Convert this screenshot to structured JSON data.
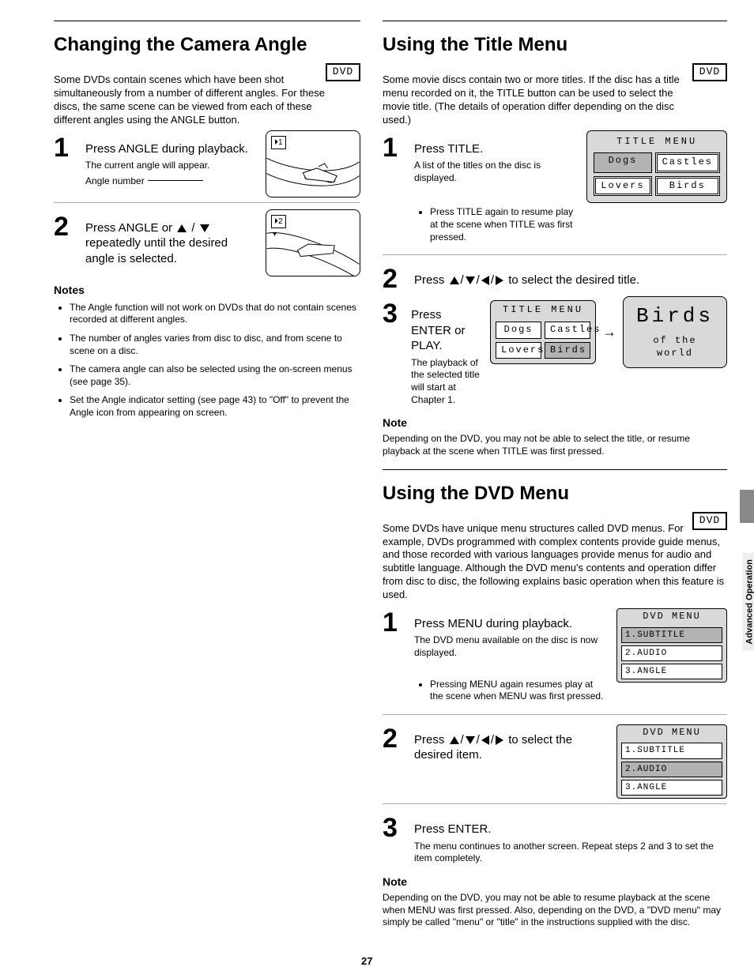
{
  "page_number": "27",
  "tab": "Advanced Operation",
  "left": {
    "title": "Changing the Camera Angle",
    "disc_label": "DVD",
    "intro": "Some DVDs contain scenes which have been shot simultaneously from a number of different angles. For these discs, the same scene can be viewed from each of these different angles using the ANGLE button.",
    "s1_n": "1",
    "s1_txt": "Press ANGLE during playback.",
    "s1_note": "The current angle will appear.",
    "angle_caption": "Angle number",
    "s2_n": "2",
    "s2_txt1": "Press ANGLE or",
    "s2_txt2": "repeatedly until the desired angle is selected.",
    "notes_label": "Notes",
    "notes": [
      "The Angle function will not work on DVDs that do not contain scenes recorded at different angles.",
      "The number of angles varies from disc to disc, and from scene to scene on a disc.",
      "The camera angle can also be selected using the on-screen menus (see page 35).",
      "Set the Angle indicator setting (see page 43) to \"Off\" to prevent the Angle icon from appearing on screen."
    ]
  },
  "right": {
    "title": "Using the Title Menu",
    "disc_label": "DVD",
    "intro": "Some movie discs contain two or more titles. If the disc has a title menu recorded on it, the TITLE button can be used to select the movie title. (The details of operation differ depending on the disc used.)",
    "s1_n": "1",
    "s1_txt": "Press TITLE.",
    "s1_note": "A list of the titles on the disc is displayed.",
    "press_again": "Press TITLE again to resume play at the scene when TITLE was first pressed.",
    "s2_n": "2",
    "s2_txt1": "Press",
    "s2_txt2": "to select the desired title.",
    "s3_n": "3",
    "s3_txt": "Press ENTER or PLAY.",
    "s3_note": "The playback of the selected title will start at Chapter 1.",
    "osd_title": "TITLE MENU",
    "osd_items": [
      "Dogs",
      "Castles",
      "Lovers",
      "Birds"
    ],
    "birds": {
      "big": "Birds",
      "sm": "of the world"
    },
    "dvd_title": "Using the DVD Menu",
    "dvd_disc_label": "DVD",
    "dvd_intro": "Some DVDs have unique menu structures called DVD menus. For example, DVDs programmed with complex contents provide guide menus, and those recorded with various languages provide menus for audio and subtitle language. Although the DVD menu's contents and operation differ from disc to disc, the following explains basic operation when this feature is used.",
    "dvd_s1_n": "1",
    "dvd_s1_txt": "Press MENU during playback.",
    "dvd_s1_note": "The DVD menu available on the disc is now displayed.",
    "dvd_press_again": "Pressing MENU again resumes play at the scene when MENU was first pressed.",
    "dvd_s2_n": "2",
    "dvd_s2_txt1": "Press",
    "dvd_s2_txt2": "to select the desired item.",
    "dvd_s3_n": "3",
    "dvd_s3_txt": "Press ENTER.",
    "dvd_s3_note": "The menu continues to another screen. Repeat steps 2 and 3 to set the item completely.",
    "dvd_menu_hdr": "DVD MENU",
    "dvd_menu_items": [
      "1.SUBTITLE",
      "2.AUDIO",
      "3.ANGLE"
    ],
    "note_title_bottom": "Note",
    "note_bottom": "Depending on the DVD, you may not be able to select the title, or resume playback at the scene when TITLE was first pressed.",
    "dvd_note_bottom": "Depending on the DVD, you may not be able to resume playback at the scene when MENU was first pressed. Also, depending on the DVD, a \"DVD menu\" may simply be called \"menu\" or \"title\" in the instructions supplied with the disc."
  }
}
